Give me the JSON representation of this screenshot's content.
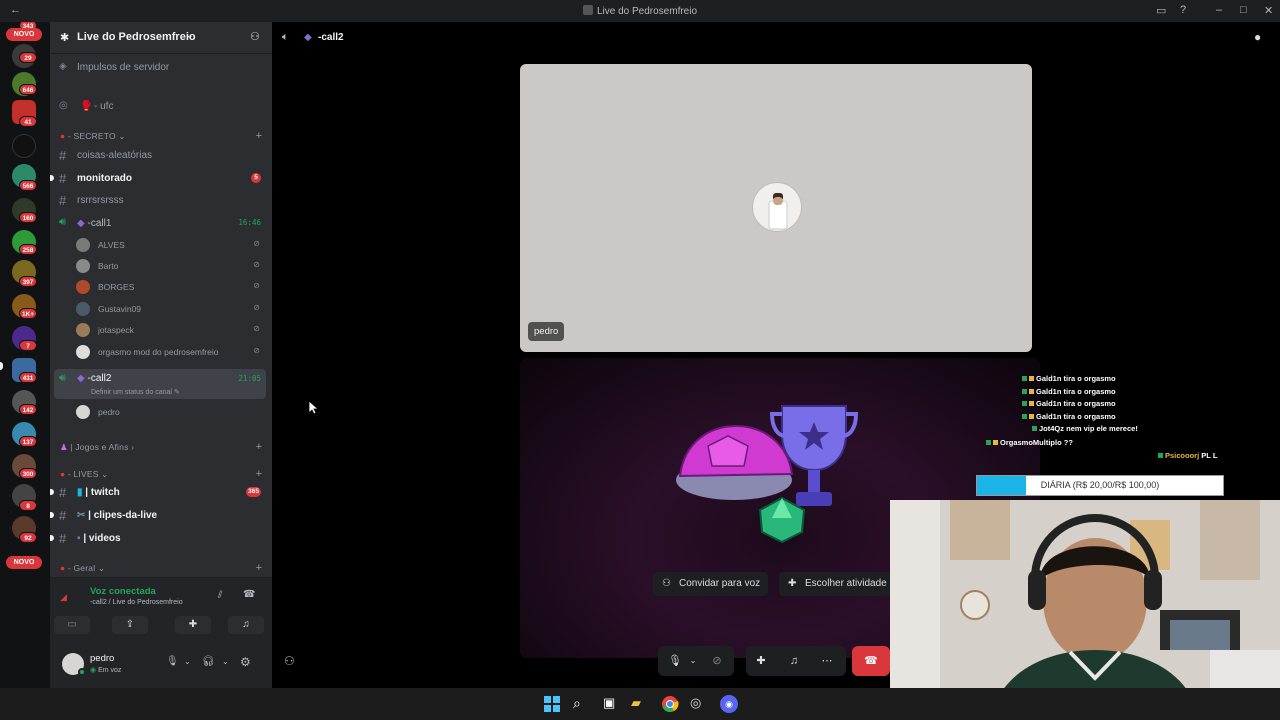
{
  "window": {
    "title": "Live do Pedrosemfreio"
  },
  "rail": {
    "top_badge": "343",
    "novo_top": "NOVO",
    "novo_bottom": "NOVO",
    "badges": [
      "29",
      "646",
      "41",
      "566",
      "160",
      "258",
      "397",
      "1K+",
      "7",
      "431",
      "142",
      "137",
      "300",
      "8",
      "92"
    ]
  },
  "server": {
    "name": "Live do Pedrosemfreio",
    "boosts": "Impulsos de servidor",
    "stage_channel": "- ufc",
    "categories": {
      "secreto": "SECRETO",
      "jogos": "Jogos e Afins",
      "lives": "LIVES",
      "geral": "Geral"
    },
    "channels": {
      "coisas": "coisas-aleatórias",
      "monitorado": "monitorado",
      "monitorado_badge": "5",
      "rsrs": "rsrrsrsrsss",
      "call1": "-call1",
      "call1_timer": "16:46",
      "call2": "-call2",
      "call2_timer": "21:05",
      "call2_status": "Definir um status do canal",
      "twitch": "| twitch",
      "twitch_badge": "365",
      "clipes": "| clipes-da-live",
      "videos": "| videos"
    },
    "call1_members": [
      "ALVES",
      "Barto",
      "BORGES",
      "Gustavin09",
      "jotaspeck",
      "orgasmo mod do pedrosemfreio"
    ],
    "call2_members": [
      "pedro"
    ]
  },
  "voice": {
    "status": "Voz conectada",
    "location": "-call2 / Live do Pedrosemfreio"
  },
  "user": {
    "name": "pedro",
    "status": "Em voz"
  },
  "main": {
    "channel": "-call2",
    "tile_name": "pedro",
    "invite_label": "Convidar para voz",
    "activity_label": "Escolher atividade"
  },
  "stream_chat": [
    {
      "user": "Gald1n",
      "msg": "tira o orgasmo"
    },
    {
      "user": "Gald1n",
      "msg": "tira o orgasmo"
    },
    {
      "user": "Gald1n",
      "msg": "tira o orgasmo"
    },
    {
      "user": "Gald1n",
      "msg": "tira o orgasmo"
    },
    {
      "user": "Jot4Qz",
      "msg": "nem vip ele merece!"
    },
    {
      "user": "OrgasmoMultiplo",
      "msg": "??"
    },
    {
      "user": "Psicooorj",
      "msg": "PL L"
    }
  ],
  "goal": {
    "label": "DIÁRIA (R$ 20,00/R$ 100,00)",
    "progress": 0.2
  },
  "colors": {
    "accent": "#5865f2",
    "green": "#23a55a",
    "red": "#da373c",
    "hangup": "#da373c"
  }
}
